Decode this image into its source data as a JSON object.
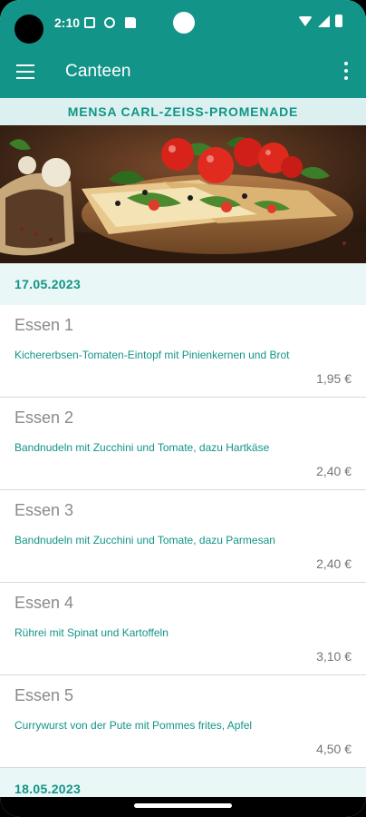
{
  "status_bar": {
    "time": "2:10",
    "icons": [
      "calendar-icon",
      "globe-icon",
      "sd-card-icon",
      "wifi-icon",
      "signal-icon",
      "battery-icon"
    ]
  },
  "app_bar": {
    "title": "Canteen",
    "menu_icon": "hamburger-menu-icon",
    "overflow_icon": "more-vert-icon"
  },
  "canteen": {
    "name": "MENSA CARL-ZEISS-PROMENADE"
  },
  "days": [
    {
      "date": "17.05.2023",
      "meals": [
        {
          "name": "Essen 1",
          "description": "Kichererbsen-Tomaten-Eintopf mit Pinienkernen und Brot",
          "price": "1,95 €"
        },
        {
          "name": "Essen 2",
          "description": "Bandnudeln mit Zucchini und Tomate, dazu Hartkäse",
          "price": "2,40 €"
        },
        {
          "name": "Essen 3",
          "description": "Bandnudeln mit Zucchini und Tomate, dazu Parmesan",
          "price": "2,40 €"
        },
        {
          "name": "Essen 4",
          "description": "Rührei mit Spinat und Kartoffeln",
          "price": "3,10 €"
        },
        {
          "name": "Essen 5",
          "description": "Currywurst von der Pute mit Pommes frites, Apfel",
          "price": "4,50 €"
        }
      ]
    },
    {
      "date": "18.05.2023",
      "meals": []
    }
  ],
  "colors": {
    "primary": "#129488",
    "header_bg": "#dcf1ef",
    "date_bg": "#e9f7f6",
    "meal_name": "#8a8a8a",
    "price": "#757575"
  }
}
